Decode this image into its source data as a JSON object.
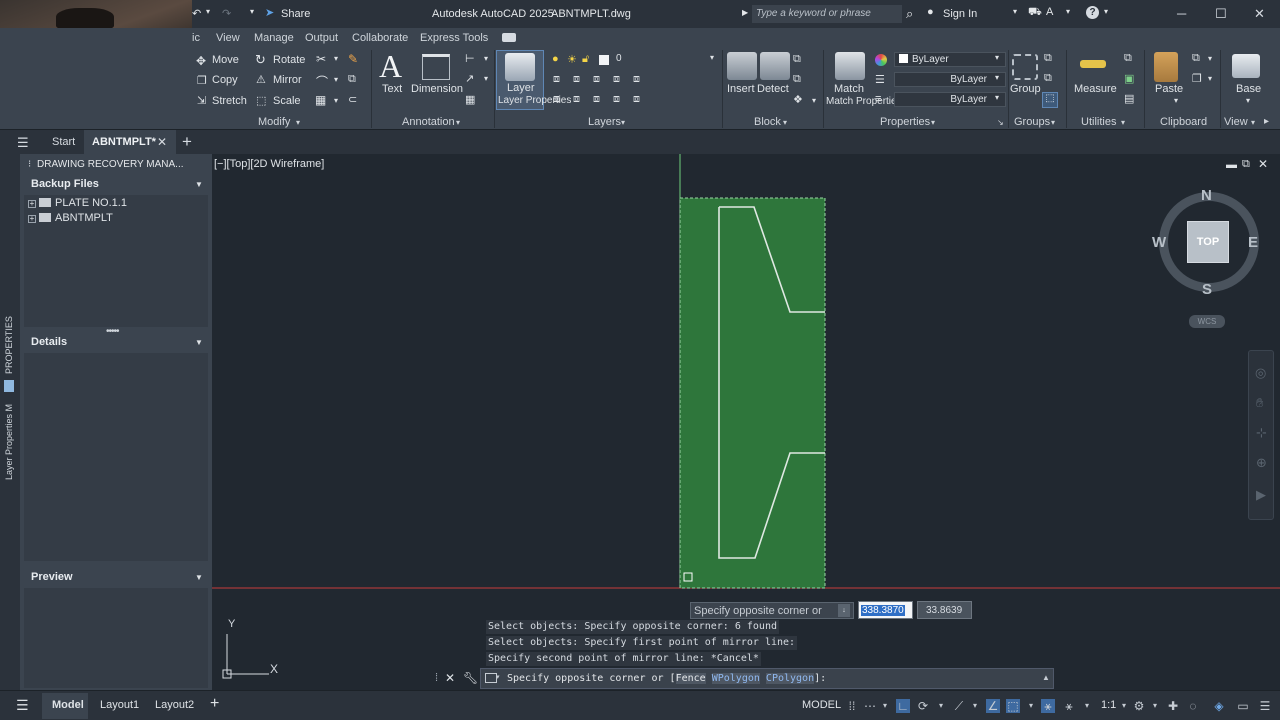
{
  "app": {
    "title": "Autodesk AutoCAD 2025",
    "file": "ABNTMPLT.dwg",
    "share_label": "Share",
    "search_placeholder": "Type a keyword or phrase",
    "sign_in": "Sign In"
  },
  "ribbon_tabs": [
    "ic",
    "View",
    "Manage",
    "Output",
    "Collaborate",
    "Express Tools"
  ],
  "ribbon": {
    "modify": {
      "title": "Modify",
      "move": "Move",
      "rotate": "Rotate",
      "copy": "Copy",
      "mirror": "Mirror",
      "stretch": "Stretch",
      "scale": "Scale"
    },
    "annotation": {
      "title": "Annotation",
      "text": "Text",
      "dimension": "Dimension"
    },
    "layers": {
      "title": "Layers",
      "layer_properties": "Layer Properties",
      "current_layer": "0"
    },
    "block": {
      "title": "Block",
      "insert": "Insert",
      "detect": "Detect"
    },
    "properties": {
      "title": "Properties",
      "match": "Match Properties",
      "color": "ByLayer",
      "linetype": "ByLayer",
      "lineweight": "ByLayer"
    },
    "groups": {
      "title": "Groups",
      "group": "Group"
    },
    "utilities": {
      "title": "Utilities",
      "measure": "Measure"
    },
    "clipboard": {
      "title": "Clipboard",
      "paste": "Paste"
    },
    "view": {
      "title": "View",
      "base": "Base"
    }
  },
  "file_tabs": {
    "start": "Start",
    "active": "ABNTMPLT*"
  },
  "recovery": {
    "title": "DRAWING RECOVERY MANA...",
    "backup_title": "Backup Files",
    "items": [
      "PLATE NO.1.1",
      "ABNTMPLT"
    ],
    "details_title": "Details",
    "preview_title": "Preview"
  },
  "side_strip": {
    "properties": "PROPERTIES",
    "layer_props": "Layer Properties M"
  },
  "viewport": {
    "label": "[−][Top][2D Wireframe]"
  },
  "viewcube": {
    "top": "TOP",
    "n": "N",
    "s": "S",
    "e": "E",
    "w": "W",
    "wcs": "WCS"
  },
  "ucs": {
    "x": "X",
    "y": "Y"
  },
  "tooltip": {
    "prompt": "Specify opposite corner or",
    "x_value": "338.3870",
    "y_value": "33.8639"
  },
  "command_history": [
    "Select objects: Specify opposite corner: 6 found",
    "Select objects:  Specify first point of mirror line:",
    "Specify second point of mirror line: *Cancel*"
  ],
  "command_prompt": {
    "prefix": "Specify opposite corner or [",
    "opt1": "Fence",
    "opt2": "WPolygon",
    "opt3": "CPolygon",
    "suffix": "]:"
  },
  "status": {
    "model_tab": "Model",
    "layout1": "Layout1",
    "layout2": "Layout2",
    "model": "MODEL",
    "scale": "1:1"
  },
  "colors": {
    "selection_fill": "#2f7a3c",
    "accent": "#4f8fd1",
    "canvas": "#212830"
  }
}
